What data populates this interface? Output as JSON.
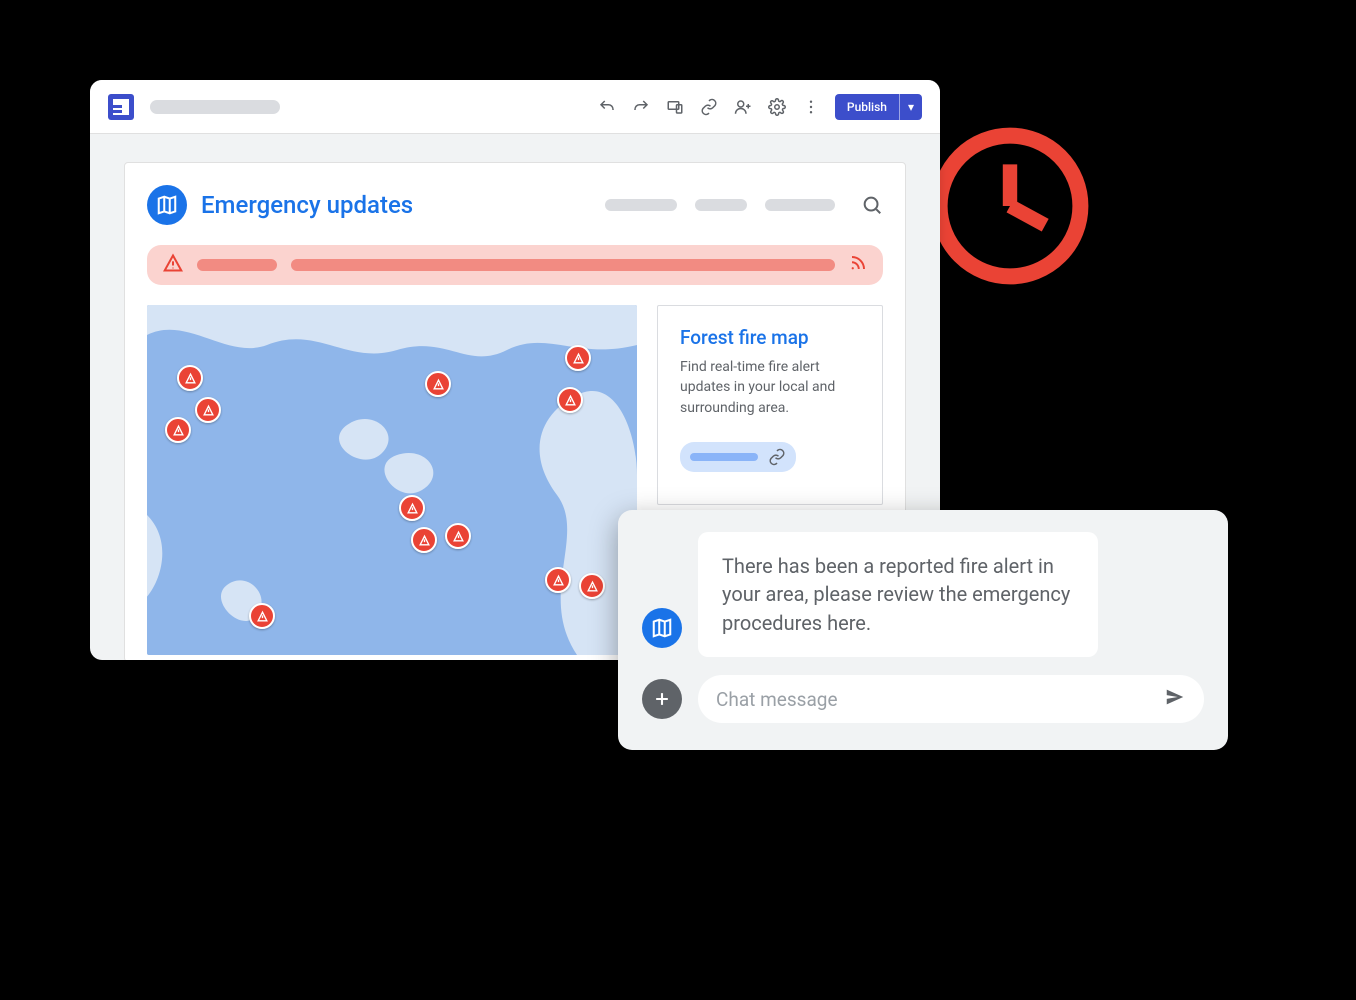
{
  "toolbar": {
    "publish_label": "Publish",
    "icons": [
      "undo",
      "redo",
      "device",
      "link",
      "add-person",
      "settings",
      "more"
    ]
  },
  "page": {
    "title": "Emergency updates"
  },
  "side_card": {
    "title": "Forest fire map",
    "body": "Find real-time fire alert updates in your local and surrounding area."
  },
  "chat": {
    "message": "There has been a reported fire alert in your area, please review the emergency procedures here.",
    "placeholder": "Chat message"
  },
  "colors": {
    "brand_blue": "#1a73e8",
    "alert_red": "#ea4335",
    "alert_bg": "#fbd3cf"
  }
}
